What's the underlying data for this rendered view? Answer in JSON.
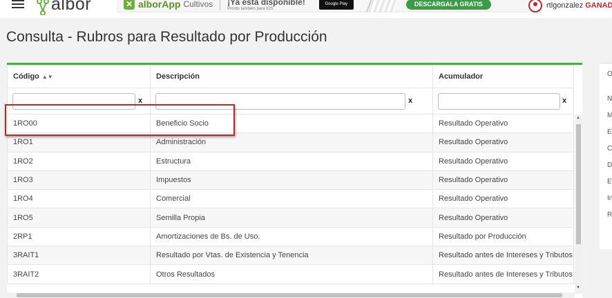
{
  "header": {
    "logo_text": "albor",
    "banner": {
      "app_name": "alborApp",
      "app_sub": "Cultivos",
      "promo_title": "¡Ya está disponible!",
      "promo_sub": "Pronto también para IOS",
      "store_label": "Google Play",
      "download_label": "DESCARGALA GRATIS"
    },
    "user": {
      "name": "rtlgonzalez",
      "role": "GANAD"
    }
  },
  "page_title": "Consulta - Rubros para Resultado por Producción",
  "table": {
    "columns": [
      "Código",
      "Descripción",
      "Acumulador"
    ],
    "clear_label": "x",
    "rows": [
      [
        "1RO00",
        "Beneficio Socio",
        "Resultado Operativo"
      ],
      [
        "1RO1",
        "Administración",
        "Resultado Operativo"
      ],
      [
        "1RO2",
        "Estructura",
        "Resultado Operativo"
      ],
      [
        "1RO3",
        "Impuestos",
        "Resultado Operativo"
      ],
      [
        "1RO4",
        "Comercial",
        "Resultado Operativo"
      ],
      [
        "1RO5",
        "Semilla Propia",
        "Resultado Operativo"
      ],
      [
        "2RP1",
        "Amortizaciones de Bs. de Uso.",
        "Resultado por Producción"
      ],
      [
        "3RAIT1",
        "Resultado por Vtas. de Existencia y Tenencia",
        "Resultado antes de Intereses y Tributos (RA"
      ],
      [
        "3RAIT2",
        "Otros Resultados",
        "Resultado antes de Intereses y Tributos (RA"
      ]
    ]
  },
  "side_panel": {
    "letters": [
      "Ol",
      "N",
      "M",
      "E",
      "C",
      "D",
      "E",
      "In",
      "R"
    ]
  }
}
